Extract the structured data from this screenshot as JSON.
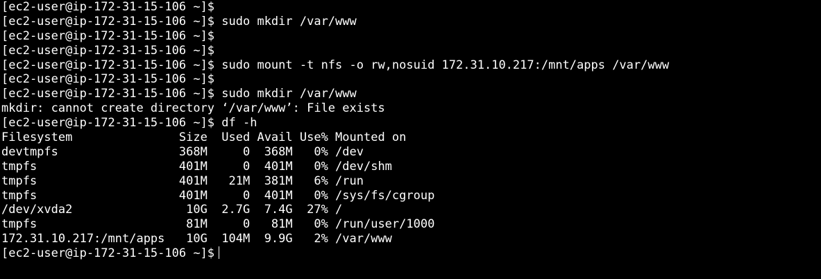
{
  "terminal": {
    "foreground": "#ffffff",
    "background": "#000000",
    "lines": [
      "[ec2-user@ip-172-31-15-106 ~]$",
      "[ec2-user@ip-172-31-15-106 ~]$ sudo mkdir /var/www",
      "[ec2-user@ip-172-31-15-106 ~]$",
      "[ec2-user@ip-172-31-15-106 ~]$",
      "[ec2-user@ip-172-31-15-106 ~]$ sudo mount -t nfs -o rw,nosuid 172.31.10.217:/mnt/apps /var/www",
      "[ec2-user@ip-172-31-15-106 ~]$",
      "[ec2-user@ip-172-31-15-106 ~]$ sudo mkdir /var/www",
      "mkdir: cannot create directory ‘/var/www’: File exists",
      "[ec2-user@ip-172-31-15-106 ~]$ df -h",
      "Filesystem               Size  Used Avail Use% Mounted on",
      "devtmpfs                 368M     0  368M   0% /dev",
      "tmpfs                    401M     0  401M   0% /dev/shm",
      "tmpfs                    401M   21M  381M   6% /run",
      "tmpfs                    401M     0  401M   0% /sys/fs/cgroup",
      "/dev/xvda2                10G  2.7G  7.4G  27% /",
      "tmpfs                     81M     0   81M   0% /run/user/1000",
      "172.31.10.217:/mnt/apps   10G  104M  9.9G   2% /var/www"
    ],
    "prompt": "[ec2-user@ip-172-31-15-106 ~]$"
  }
}
